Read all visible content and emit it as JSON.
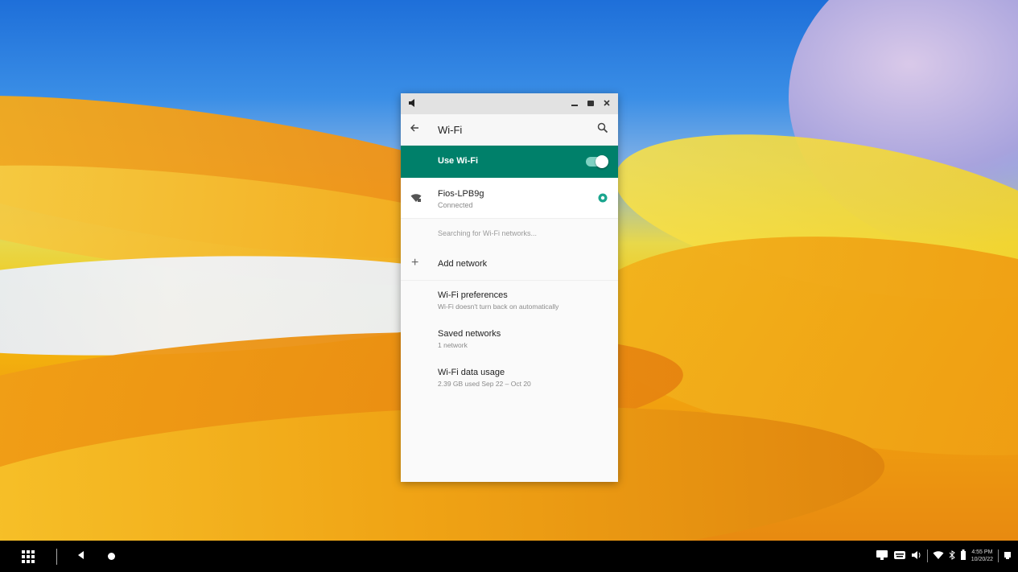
{
  "window": {
    "title_icon": "volume-icon",
    "controls": {
      "minimize": "minimize-icon",
      "maximize": "maximize-icon",
      "close": "close-icon"
    }
  },
  "appbar": {
    "title": "Wi-Fi",
    "back_icon": "back-arrow-icon",
    "search_icon": "search-icon"
  },
  "use_wifi": {
    "label": "Use Wi-Fi",
    "enabled": true,
    "accent": "#00806a"
  },
  "connected_network": {
    "name": "Fios-LPB9g",
    "status": "Connected",
    "signal_icon": "wifi-lock-icon",
    "settings_icon": "gear-icon"
  },
  "searching_text": "Searching for Wi-Fi networks...",
  "add_network": {
    "label": "Add network",
    "icon": "plus-icon"
  },
  "items": [
    {
      "title": "Wi-Fi preferences",
      "subtitle": "Wi-Fi doesn't turn back on automatically"
    },
    {
      "title": "Saved networks",
      "subtitle": "1 network"
    },
    {
      "title": "Wi-Fi data usage",
      "subtitle": "2.39 GB used Sep 22 – Oct 20"
    }
  ],
  "taskbar": {
    "launcher_icon": "app-launcher-icon",
    "back_icon": "back-icon",
    "home_icon": "home-icon",
    "tray_icons": [
      "screen-cast-icon",
      "keyboard-icon",
      "volume-icon",
      "wifi-icon",
      "bluetooth-icon",
      "battery-icon"
    ],
    "time": "4:55 PM",
    "date": "10/20/22"
  }
}
